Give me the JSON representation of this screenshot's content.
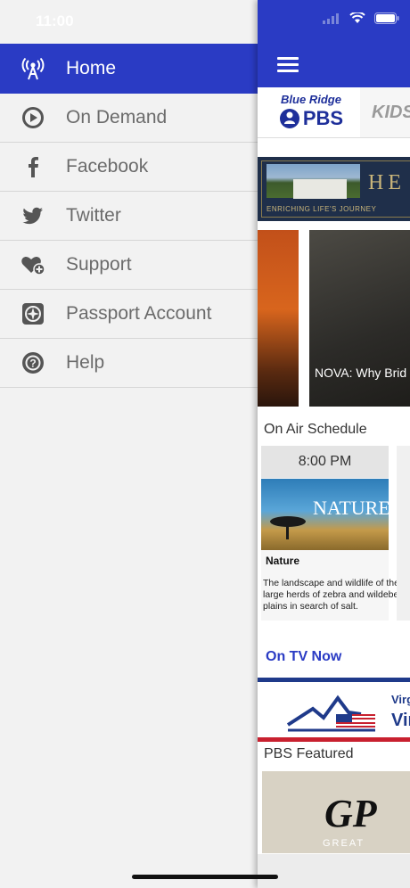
{
  "status_bar": {
    "time": "11:00"
  },
  "menu": {
    "items": [
      {
        "label": "Home",
        "icon": "broadcast-tower-icon",
        "active": true
      },
      {
        "label": "On Demand",
        "icon": "play-circle-icon"
      },
      {
        "label": "Facebook",
        "icon": "facebook-icon"
      },
      {
        "label": "Twitter",
        "icon": "twitter-icon"
      },
      {
        "label": "Support",
        "icon": "heart-plus-icon"
      },
      {
        "label": "Passport Account",
        "icon": "compass-icon"
      },
      {
        "label": "Help",
        "icon": "help-circle-icon"
      }
    ]
  },
  "app": {
    "station_tabs": {
      "primary_line1": "Blue Ridge",
      "primary_line2": "PBS",
      "secondary": "KIDS"
    },
    "banner": {
      "title": "HE",
      "tagline": "ENRICHING LIFE'S JOURNEY"
    },
    "carousel": {
      "card_label": "NOVA: Why Brid"
    },
    "on_air": {
      "title": "On Air Schedule",
      "time": "8:00 PM",
      "image_text": "NATURE",
      "show": "Nature",
      "description": "The landscape and wildlife of the large herds of zebra and wildebee plains in search of salt."
    },
    "on_tv_now": "On TV Now",
    "vtv": {
      "line1": "Virg",
      "line2": "Vir"
    },
    "pbs_featured": {
      "title": "PBS Featured",
      "logo": "GP",
      "caption": "GREAT"
    }
  },
  "colors": {
    "accent": "#2a3bc4",
    "menu_text": "#6b6b6b",
    "background": "#f2f2f2"
  }
}
